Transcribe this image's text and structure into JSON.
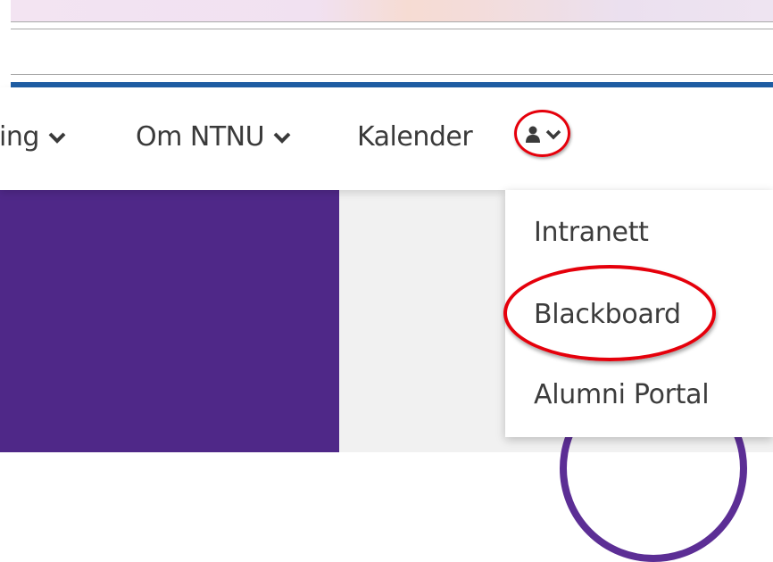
{
  "nav": {
    "items": [
      {
        "label": "ing",
        "has_chevron": true
      },
      {
        "label": "Om NTNU",
        "has_chevron": true
      },
      {
        "label": "Kalender",
        "has_chevron": false
      }
    ],
    "user_menu_icon": "user-icon"
  },
  "dropdown": {
    "items": [
      "Intranett",
      "Blackboard",
      "Alumni Portal"
    ],
    "highlighted": "Blackboard"
  },
  "colors": {
    "brand_blue": "#1f5da3",
    "purple": "#4f2888",
    "annotation_red": "#e5000b"
  }
}
